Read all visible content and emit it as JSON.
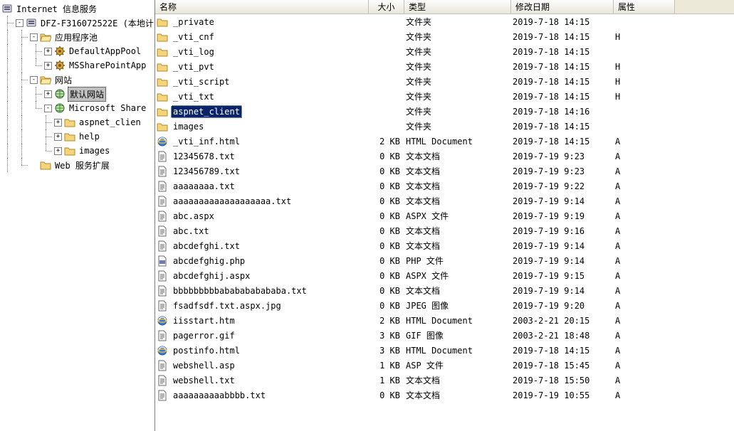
{
  "tree": {
    "root": "Internet 信息服务",
    "server": "DFZ-F316072522E (本地计",
    "appPools": "应用程序池",
    "defaultAppPool": "DefaultAppPool",
    "msSharePointApp": "MSSharePointApp",
    "sites": "网站",
    "defaultSite": "默认网站",
    "microsoftShare": "Microsoft Share",
    "aspnetClient": "aspnet_clien",
    "help": "help",
    "images": "images",
    "webExt": "Web 服务扩展"
  },
  "headers": {
    "name": "名称",
    "size": "大小",
    "type": "类型",
    "date": "修改日期",
    "attr": "属性"
  },
  "rows": [
    {
      "name": "_private",
      "icon": "folder",
      "size": "",
      "type": "文件夹",
      "date": "2019-7-18 14:15",
      "attr": ""
    },
    {
      "name": "_vti_cnf",
      "icon": "folder",
      "size": "",
      "type": "文件夹",
      "date": "2019-7-18 14:15",
      "attr": "H"
    },
    {
      "name": "_vti_log",
      "icon": "folder",
      "size": "",
      "type": "文件夹",
      "date": "2019-7-18 14:15",
      "attr": ""
    },
    {
      "name": "_vti_pvt",
      "icon": "folder",
      "size": "",
      "type": "文件夹",
      "date": "2019-7-18 14:15",
      "attr": "H"
    },
    {
      "name": "_vti_script",
      "icon": "folder",
      "size": "",
      "type": "文件夹",
      "date": "2019-7-18 14:15",
      "attr": "H"
    },
    {
      "name": "_vti_txt",
      "icon": "folder",
      "size": "",
      "type": "文件夹",
      "date": "2019-7-18 14:15",
      "attr": "H"
    },
    {
      "name": "aspnet_client",
      "icon": "folder",
      "size": "",
      "type": "文件夹",
      "date": "2019-7-18 14:16",
      "attr": "",
      "selected": true
    },
    {
      "name": "images",
      "icon": "folder",
      "size": "",
      "type": "文件夹",
      "date": "2019-7-18 14:15",
      "attr": ""
    },
    {
      "name": "_vti_inf.html",
      "icon": "ie",
      "size": "2 KB",
      "type": "HTML Document",
      "date": "2019-7-18 14:15",
      "attr": "A"
    },
    {
      "name": "12345678.txt",
      "icon": "text",
      "size": "0 KB",
      "type": "文本文档",
      "date": "2019-7-19 9:23",
      "attr": "A"
    },
    {
      "name": "123456789.txt",
      "icon": "text",
      "size": "0 KB",
      "type": "文本文档",
      "date": "2019-7-19 9:23",
      "attr": "A"
    },
    {
      "name": "aaaaaaaa.txt",
      "icon": "text",
      "size": "0 KB",
      "type": "文本文档",
      "date": "2019-7-19 9:22",
      "attr": "A"
    },
    {
      "name": "aaaaaaaaaaaaaaaaaaa.txt",
      "icon": "text",
      "size": "0 KB",
      "type": "文本文档",
      "date": "2019-7-19 9:14",
      "attr": "A"
    },
    {
      "name": "abc.aspx",
      "icon": "text",
      "size": "0 KB",
      "type": "ASPX 文件",
      "date": "2019-7-19 9:19",
      "attr": "A"
    },
    {
      "name": "abc.txt",
      "icon": "text",
      "size": "0 KB",
      "type": "文本文档",
      "date": "2019-7-19 9:16",
      "attr": "A"
    },
    {
      "name": "abcdefghi.txt",
      "icon": "text",
      "size": "0 KB",
      "type": "文本文档",
      "date": "2019-7-19 9:14",
      "attr": "A"
    },
    {
      "name": "abcdefghig.php",
      "icon": "php",
      "size": "0 KB",
      "type": "PHP 文件",
      "date": "2019-7-19 9:14",
      "attr": "A"
    },
    {
      "name": "abcdefghij.aspx",
      "icon": "text",
      "size": "0 KB",
      "type": "ASPX 文件",
      "date": "2019-7-19 9:15",
      "attr": "A"
    },
    {
      "name": "bbbbbbbbbababababababa.txt",
      "icon": "text",
      "size": "0 KB",
      "type": "文本文档",
      "date": "2019-7-19 9:14",
      "attr": "A"
    },
    {
      "name": "fsadfsdf.txt.aspx.jpg",
      "icon": "text",
      "size": "0 KB",
      "type": "JPEG 图像",
      "date": "2019-7-19 9:20",
      "attr": "A"
    },
    {
      "name": "iisstart.htm",
      "icon": "ie",
      "size": "2 KB",
      "type": "HTML Document",
      "date": "2003-2-21 20:15",
      "attr": "A"
    },
    {
      "name": "pagerror.gif",
      "icon": "text",
      "size": "3 KB",
      "type": "GIF 图像",
      "date": "2003-2-21 18:48",
      "attr": "A"
    },
    {
      "name": "postinfo.html",
      "icon": "ie",
      "size": "3 KB",
      "type": "HTML Document",
      "date": "2019-7-18 14:15",
      "attr": "A"
    },
    {
      "name": "webshell.asp",
      "icon": "text",
      "size": "1 KB",
      "type": "ASP 文件",
      "date": "2019-7-18 15:45",
      "attr": "A"
    },
    {
      "name": "webshell.txt",
      "icon": "text",
      "size": "1 KB",
      "type": "文本文档",
      "date": "2019-7-18 15:50",
      "attr": "A"
    },
    {
      "name": "aaaaaaaaaabbbb.txt",
      "icon": "text",
      "size": "0 KB",
      "type": "文本文档",
      "date": "2019-7-19 10:55",
      "attr": "A"
    }
  ]
}
